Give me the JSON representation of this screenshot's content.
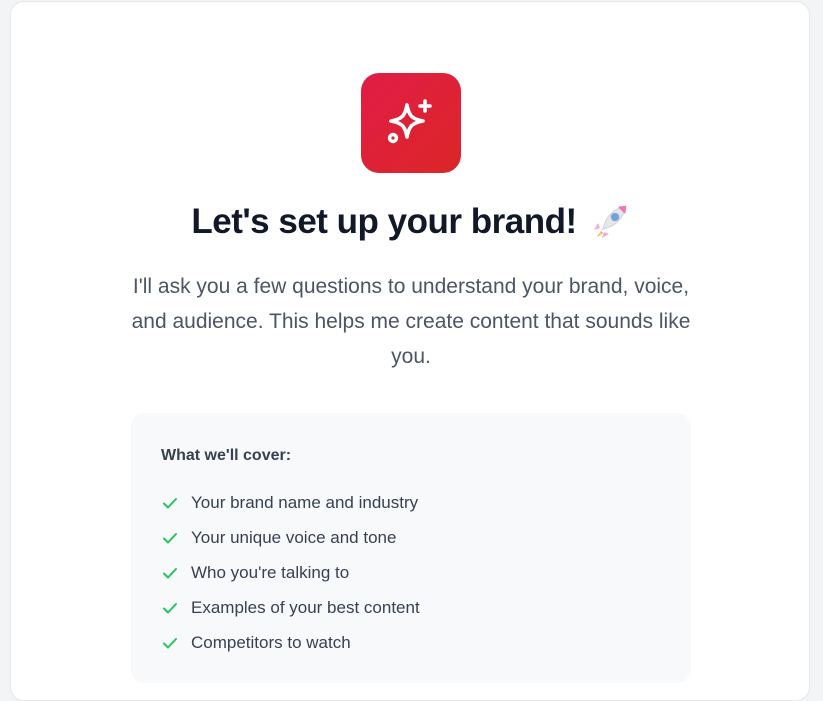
{
  "onboarding": {
    "headline": "Let's set up your brand!",
    "headline_emoji_icon": "rocket-icon",
    "logo_icon": "sparkles-icon",
    "intro": "I'll ask you a few questions to understand your brand, voice, and audience. This helps me create content that sounds like you."
  },
  "coverage": {
    "title": "What we'll cover:",
    "items": [
      {
        "label": "Your brand name and industry"
      },
      {
        "label": "Your unique voice and tone"
      },
      {
        "label": "Who you're talking to"
      },
      {
        "label": "Examples of your best content"
      },
      {
        "label": "Competitors to watch"
      }
    ]
  },
  "colors": {
    "brand_gradient_start": "#e11d48",
    "brand_gradient_end": "#dc2626",
    "check_green": "#22c55e",
    "heading": "#111827",
    "body_text": "#4b5563",
    "panel_bg": "#f8f9fb"
  }
}
